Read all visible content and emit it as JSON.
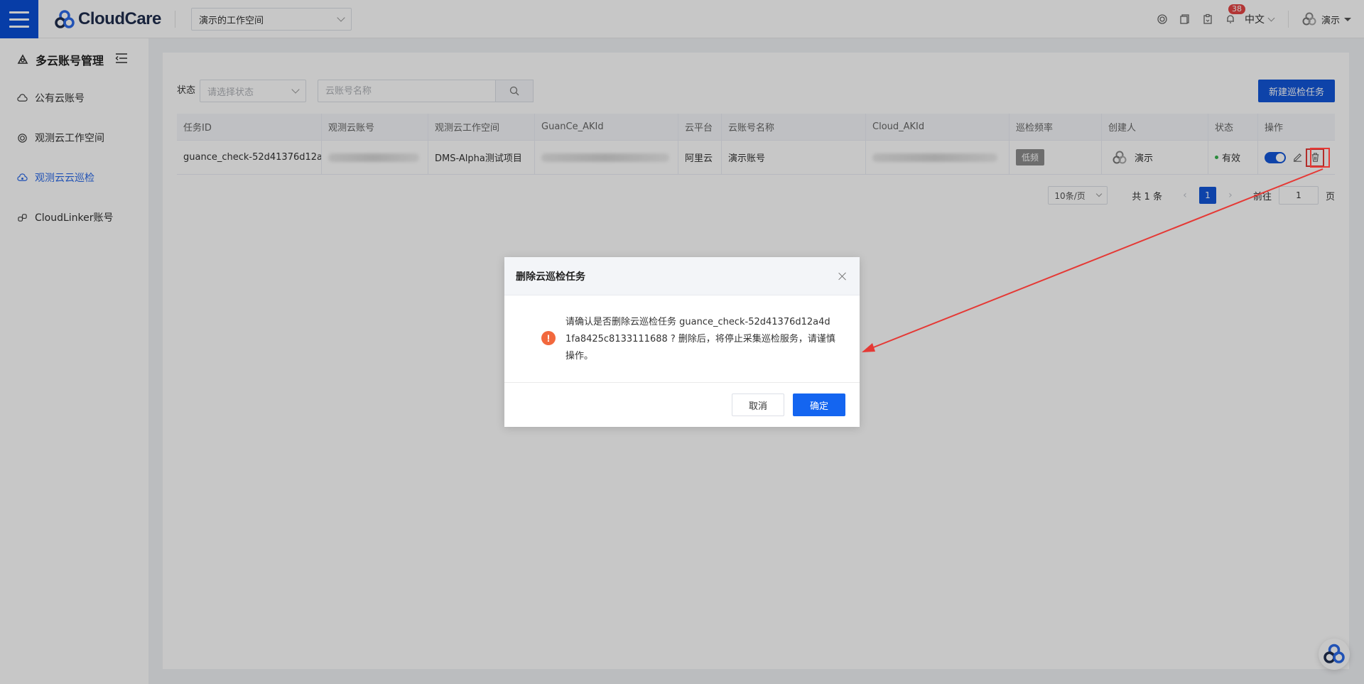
{
  "header": {
    "logo_text": "CloudCare",
    "workspace": "演示的工作空间",
    "notification_count": "38",
    "language": "中文",
    "user_name": "演示"
  },
  "sidebar": {
    "title": "多云账号管理",
    "items": [
      {
        "label": "公有云账号",
        "icon": "cloud-icon"
      },
      {
        "label": "观测云工作空间",
        "icon": "workspace-icon"
      },
      {
        "label": "观测云云巡检",
        "icon": "inspection-icon",
        "active": true
      },
      {
        "label": "CloudLinker账号",
        "icon": "link-icon"
      }
    ]
  },
  "filters": {
    "status_label": "状态",
    "status_placeholder": "请选择状态",
    "search_placeholder": "云账号名称",
    "new_button": "新建巡检任务"
  },
  "table": {
    "columns": [
      "任务ID",
      "观测云账号",
      "观测云工作空间",
      "GuanCe_AKId",
      "云平台",
      "云账号名称",
      "Cloud_AKId",
      "巡检频率",
      "创建人",
      "状态",
      "操作"
    ],
    "rows": [
      {
        "task_id": "guance_check-52d41376d12a4...",
        "workspace": "DMS-Alpha测试项目",
        "platform": "阿里云",
        "account_name": "演示账号",
        "frequency": "低频",
        "creator": "演示",
        "status": "有效"
      }
    ]
  },
  "pagination": {
    "page_size": "10条/页",
    "total": "共 1 条",
    "current_page": "1",
    "goto_label": "前往",
    "goto_value": "1",
    "page_unit": "页"
  },
  "dialog": {
    "title": "删除云巡检任务",
    "message": "请确认是否删除云巡检任务 guance_check-52d41376d12a4d1fa8425c8133111688 ? 删除后，将停止采集巡检服务，请谨慎操作。",
    "cancel": "取消",
    "confirm": "确定"
  },
  "colors": {
    "primary": "#1256d9",
    "warning": "#f2683d",
    "annotation": "#e53935"
  }
}
